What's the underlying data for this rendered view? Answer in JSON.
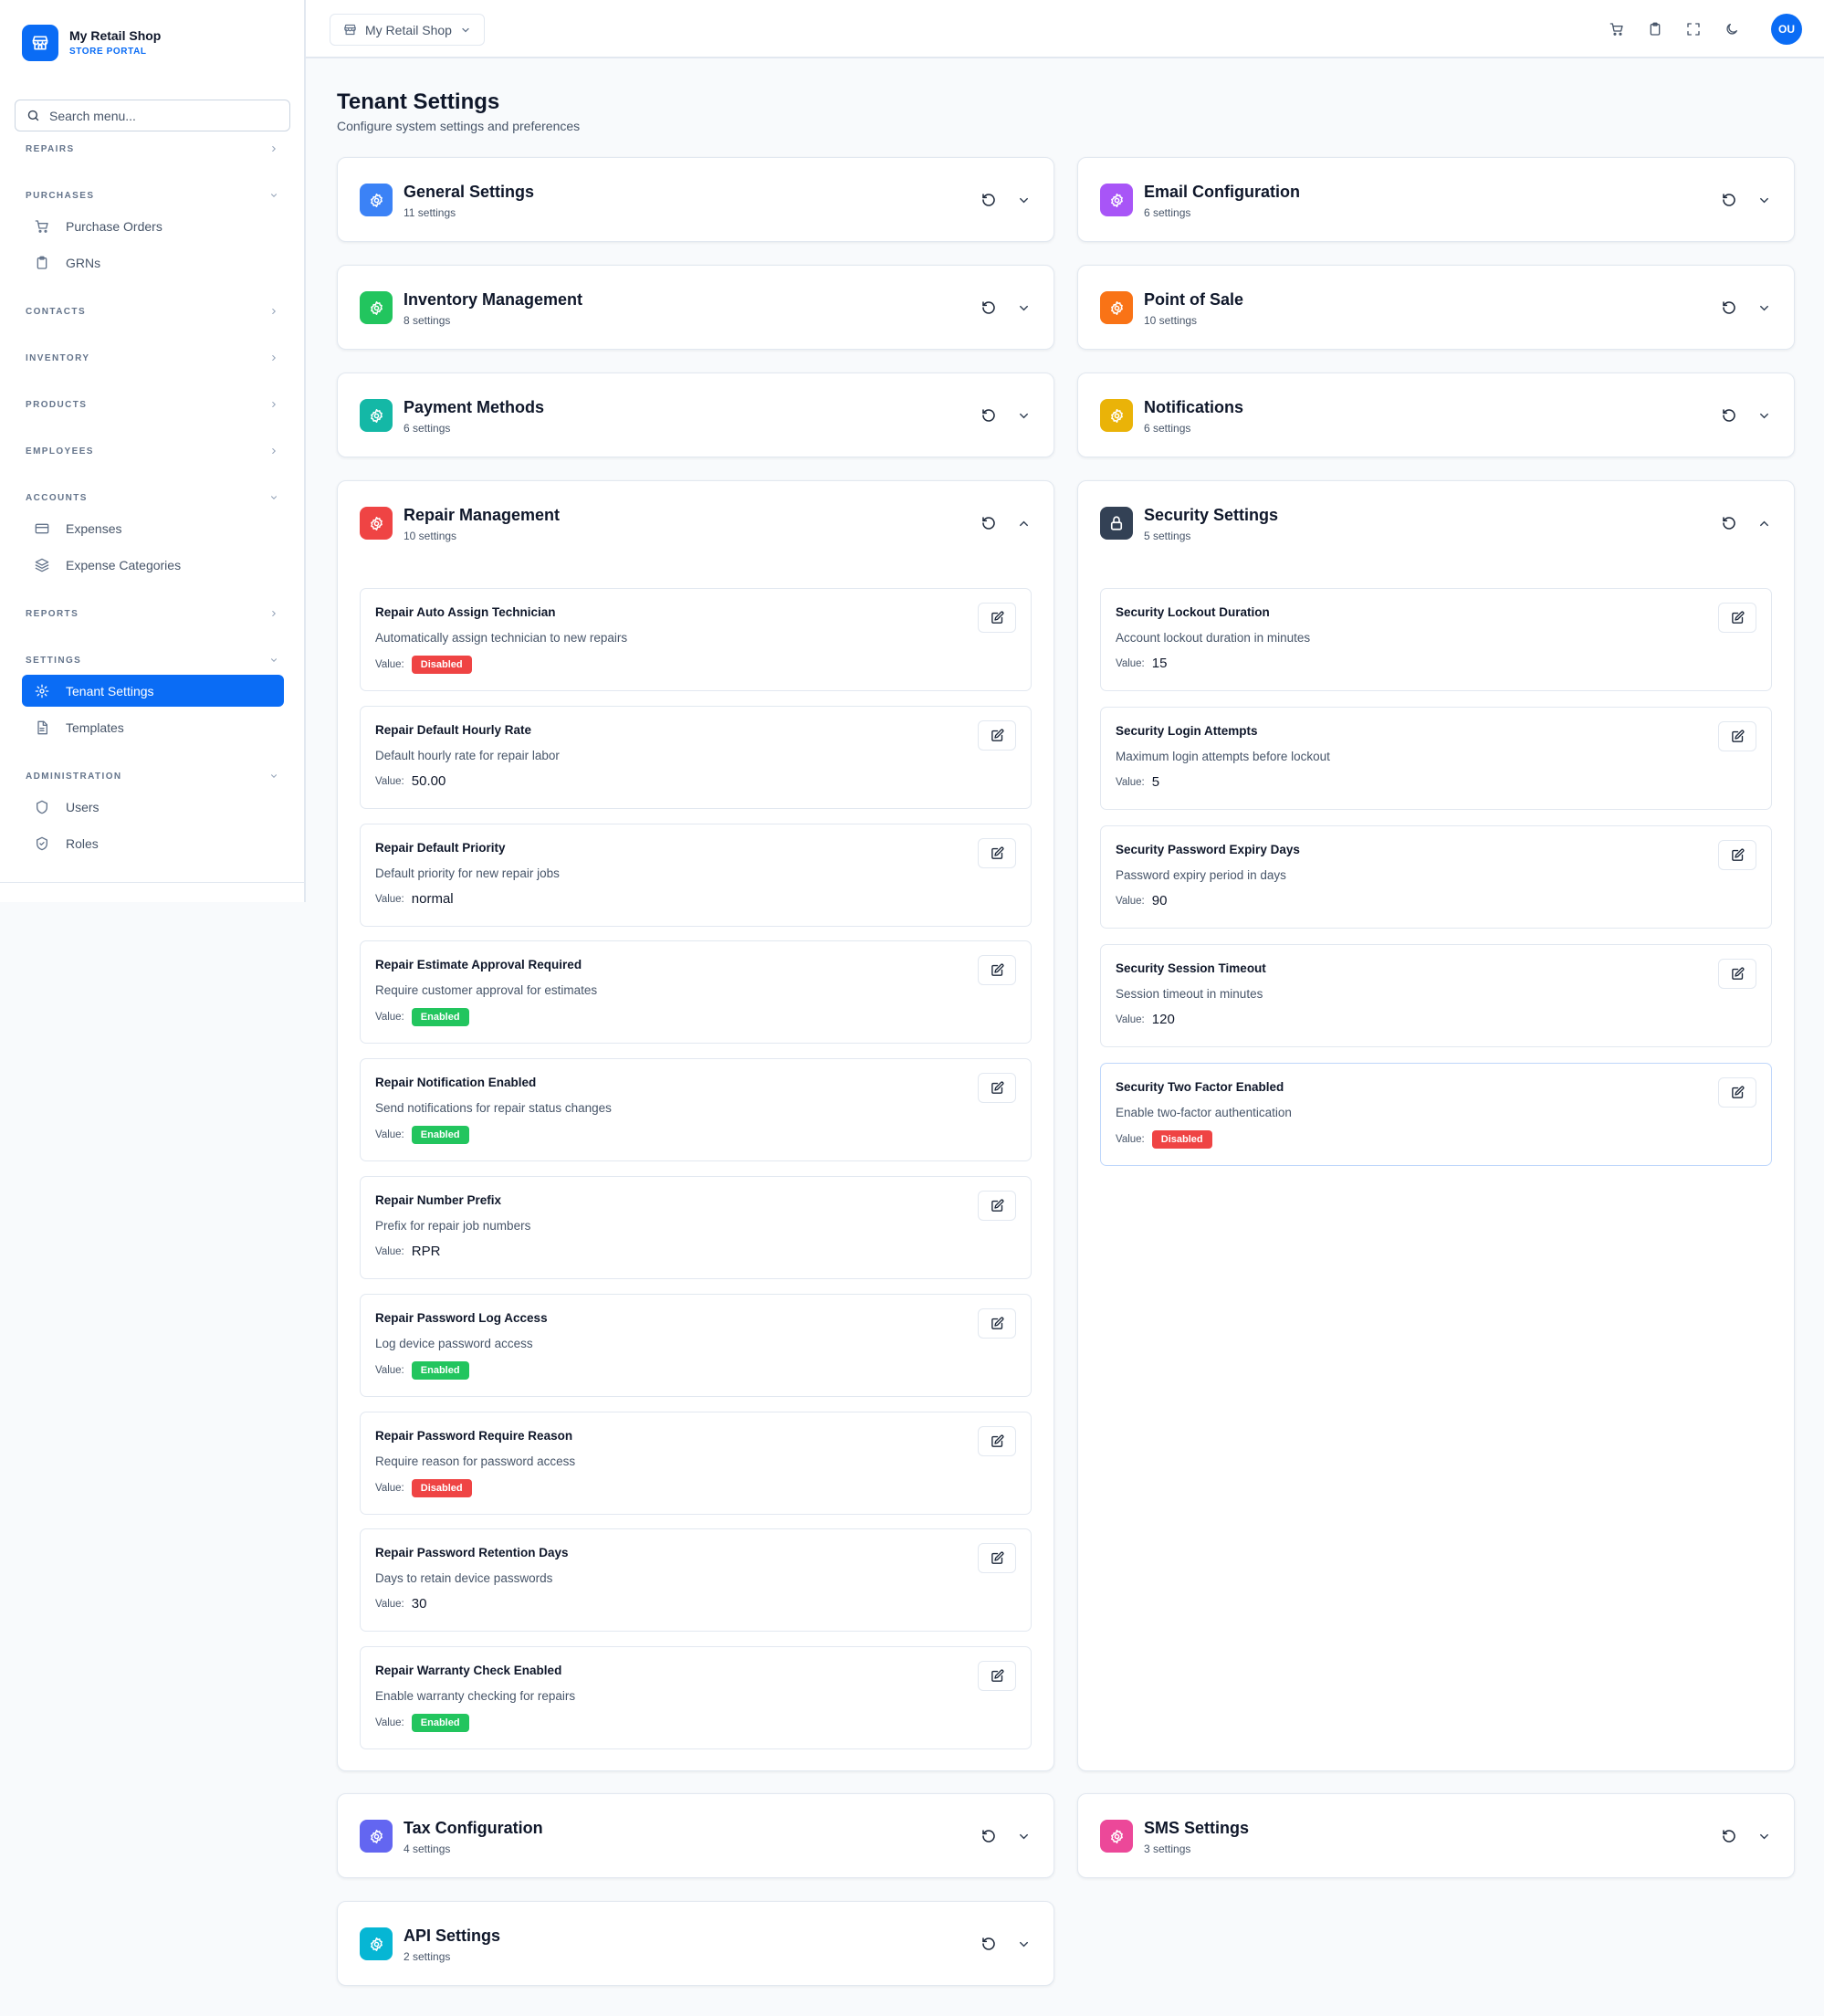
{
  "brand": {
    "name": "My Retail Shop",
    "subtitle": "STORE PORTAL",
    "color": "#0a6cf5"
  },
  "sidebar": {
    "search_placeholder": "Search menu...",
    "groups": [
      {
        "label": "REPAIRS",
        "state": "collapsed"
      },
      {
        "label": "PURCHASES",
        "state": "expanded",
        "items": [
          {
            "label": "Purchase Orders",
            "icon": "cart-icon"
          },
          {
            "label": "GRNs",
            "icon": "clipboard-icon"
          }
        ]
      },
      {
        "label": "CONTACTS",
        "state": "collapsed"
      },
      {
        "label": "INVENTORY",
        "state": "collapsed"
      },
      {
        "label": "PRODUCTS",
        "state": "collapsed"
      },
      {
        "label": "EMPLOYEES",
        "state": "collapsed"
      },
      {
        "label": "ACCOUNTS",
        "state": "expanded",
        "items": [
          {
            "label": "Expenses",
            "icon": "credit-card-icon"
          },
          {
            "label": "Expense Categories",
            "icon": "layers-icon"
          }
        ]
      },
      {
        "label": "REPORTS",
        "state": "collapsed"
      },
      {
        "label": "SETTINGS",
        "state": "expanded",
        "items": [
          {
            "label": "Tenant Settings",
            "icon": "gear-icon",
            "active": true
          },
          {
            "label": "Templates",
            "icon": "file-icon"
          }
        ]
      },
      {
        "label": "ADMINISTRATION",
        "state": "expanded",
        "items": [
          {
            "label": "Users",
            "icon": "shield-icon"
          },
          {
            "label": "Roles",
            "icon": "shield-check-icon"
          }
        ]
      }
    ]
  },
  "topbar": {
    "shop_selector": "My Retail Shop",
    "icons": [
      "cart-icon",
      "clipboard-icon",
      "fullscreen-icon",
      "moon-icon"
    ],
    "avatar_initials": "OU"
  },
  "page": {
    "title": "Tenant Settings",
    "subtitle": "Configure system settings and preferences"
  },
  "value_label": "Value:",
  "sections": {
    "general": {
      "title": "General Settings",
      "count": "11 settings",
      "color": "#3b82f6"
    },
    "email": {
      "title": "Email Configuration",
      "count": "6 settings",
      "color": "#a855f7"
    },
    "inventory": {
      "title": "Inventory Management",
      "count": "8 settings",
      "color": "#22c55e"
    },
    "pos": {
      "title": "Point of Sale",
      "count": "10 settings",
      "color": "#f97316"
    },
    "payment": {
      "title": "Payment Methods",
      "count": "6 settings",
      "color": "#14b8a6"
    },
    "notifications": {
      "title": "Notifications",
      "count": "6 settings",
      "color": "#eab308"
    },
    "repair": {
      "title": "Repair Management",
      "count": "10 settings",
      "color": "#ef4444",
      "settings": [
        {
          "name": "Repair Auto Assign Technician",
          "description": "Automatically assign technician to new repairs",
          "value": "Disabled",
          "type": "badge"
        },
        {
          "name": "Repair Default Hourly Rate",
          "description": "Default hourly rate for repair labor",
          "value": "50.00",
          "type": "text"
        },
        {
          "name": "Repair Default Priority",
          "description": "Default priority for new repair jobs",
          "value": "normal",
          "type": "text"
        },
        {
          "name": "Repair Estimate Approval Required",
          "description": "Require customer approval for estimates",
          "value": "Enabled",
          "type": "badge"
        },
        {
          "name": "Repair Notification Enabled",
          "description": "Send notifications for repair status changes",
          "value": "Enabled",
          "type": "badge"
        },
        {
          "name": "Repair Number Prefix",
          "description": "Prefix for repair job numbers",
          "value": "RPR",
          "type": "text"
        },
        {
          "name": "Repair Password Log Access",
          "description": "Log device password access",
          "value": "Enabled",
          "type": "badge"
        },
        {
          "name": "Repair Password Require Reason",
          "description": "Require reason for password access",
          "value": "Disabled",
          "type": "badge"
        },
        {
          "name": "Repair Password Retention Days",
          "description": "Days to retain device passwords",
          "value": "30",
          "type": "text"
        },
        {
          "name": "Repair Warranty Check Enabled",
          "description": "Enable warranty checking for repairs",
          "value": "Enabled",
          "type": "badge"
        }
      ]
    },
    "security": {
      "title": "Security Settings",
      "count": "5 settings",
      "color": "#334155",
      "settings": [
        {
          "name": "Security Lockout Duration",
          "description": "Account lockout duration in minutes",
          "value": "15",
          "type": "text"
        },
        {
          "name": "Security Login Attempts",
          "description": "Maximum login attempts before lockout",
          "value": "5",
          "type": "text"
        },
        {
          "name": "Security Password Expiry Days",
          "description": "Password expiry period in days",
          "value": "90",
          "type": "text"
        },
        {
          "name": "Security Session Timeout",
          "description": "Session timeout in minutes",
          "value": "120",
          "type": "text"
        },
        {
          "name": "Security Two Factor Enabled",
          "description": "Enable two-factor authentication",
          "value": "Disabled",
          "type": "badge"
        }
      ]
    },
    "tax": {
      "title": "Tax Configuration",
      "count": "4 settings",
      "color": "#6366f1"
    },
    "sms": {
      "title": "SMS Settings",
      "count": "3 settings",
      "color": "#ec4899"
    },
    "api": {
      "title": "API Settings",
      "count": "2 settings",
      "color": "#06b6d4"
    }
  }
}
